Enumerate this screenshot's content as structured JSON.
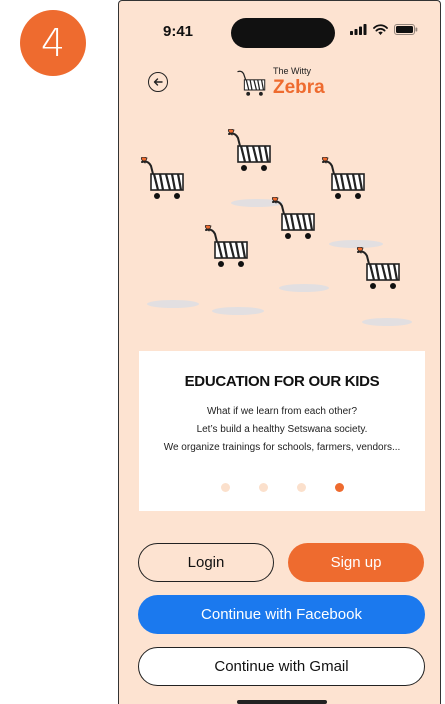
{
  "step": {
    "number": "4"
  },
  "status_bar": {
    "time": "9:41"
  },
  "header": {
    "back_icon": "arrow-left-circle-icon",
    "logo_small": "The Witty",
    "logo_big": "Zebra"
  },
  "onboarding": {
    "title": "EDUCATION FOR OUR KIDS",
    "lines": [
      "What if we learn from each other?",
      "Let’s build a healthy  Setswana society.",
      "We organize trainings for schools, farmers, vendors..."
    ],
    "page_count": 4,
    "active_page": 4
  },
  "buttons": {
    "login": "Login",
    "signup": "Sign up",
    "facebook": "Continue with Facebook",
    "gmail": "Continue with Gmail"
  },
  "colors": {
    "accent": "#ee6b2f",
    "facebook": "#1b79ee",
    "background": "#fde3d1"
  }
}
